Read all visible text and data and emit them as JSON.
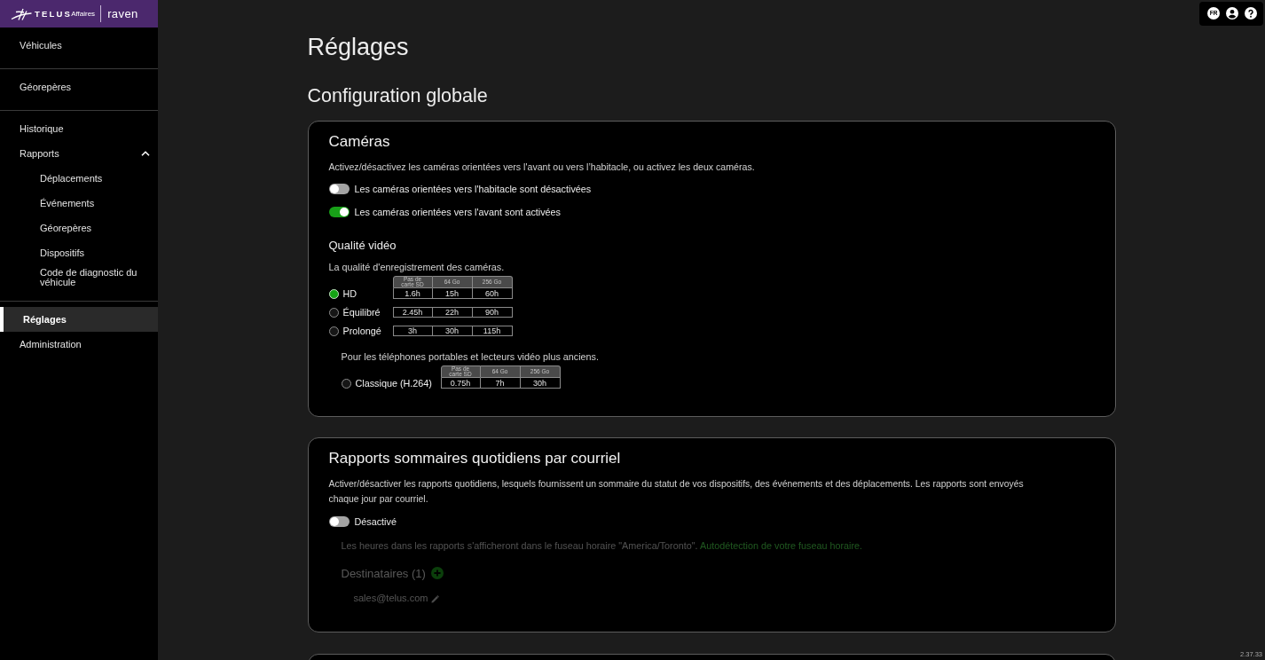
{
  "header": {
    "brand": "TELUS",
    "brand_suffix": "Affaires",
    "product": "raven"
  },
  "sidebar": {
    "groups": [
      [
        {
          "label": "Véhicules",
          "selected": false
        }
      ],
      [
        {
          "label": "Géorepères",
          "selected": false
        }
      ],
      [
        {
          "label": "Historique",
          "selected": false
        },
        {
          "label": "Rapports",
          "selected": false,
          "expanded": true,
          "children": [
            {
              "label": "Déplacements",
              "selected": false
            },
            {
              "label": "Événements",
              "selected": false
            },
            {
              "label": "Géorepères",
              "selected": false
            },
            {
              "label": "Dispositifs",
              "selected": false
            },
            {
              "label": "Code de diagnostic du véhicule",
              "selected": false
            }
          ]
        }
      ],
      [
        {
          "label": "Réglages",
          "selected": true
        },
        {
          "label": "Administration",
          "selected": false
        }
      ]
    ]
  },
  "toolbar": {
    "language": "FR"
  },
  "page_title": "Réglages",
  "section_title": "Configuration globale",
  "cameras": {
    "title": "Caméras",
    "description": "Activez/désactivez les caméras orientées vers l'avant ou vers l’habitacle, ou activez les deux caméras.",
    "toggles": [
      {
        "label": "Les caméras orientées vers l'habitacle sont désactivées",
        "on": false
      },
      {
        "label": "Les caméras orientées vers l'avant sont activées",
        "on": true
      }
    ],
    "video_quality": {
      "title": "Qualité vidéo",
      "description": "La qualité d'enregistrement des caméras.",
      "options": [
        {
          "label": "HD",
          "selected": true,
          "table": {
            "columns": [
              "Pas de carte SD",
              "64 Go",
              "256 Go"
            ],
            "values": [
              "1.6h",
              "15h",
              "60h"
            ]
          }
        },
        {
          "label": "Équilibré",
          "selected": false,
          "table": {
            "values": [
              "2.45h",
              "22h",
              "90h"
            ]
          }
        },
        {
          "label": "Prolongé",
          "selected": false,
          "table": {
            "values": [
              "3h",
              "30h",
              "115h"
            ]
          }
        }
      ],
      "legacy_note": "Pour les téléphones portables et lecteurs vidéo plus anciens.",
      "legacy_options": [
        {
          "label": "Classique (H.264)",
          "selected": false,
          "table": {
            "columns": [
              "Pas de carte SD",
              "64 Go",
              "256 Go"
            ],
            "values": [
              "0.75h",
              "7h",
              "30h"
            ]
          }
        }
      ]
    }
  },
  "daily_reports": {
    "title": "Rapports sommaires quotidiens par courriel",
    "description": "Activer/désactiver les rapports quotidiens, lesquels fournissent un sommaire du statut de vos dispositifs, des événements et des déplacements. Les rapports sont envoyés chaque jour par courriel.",
    "toggle": {
      "label": "Désactivé",
      "on": false
    },
    "timezone_note": "Les heures dans les rapports s'afficheront dans le fuseau horaire \"America/Toronto\".",
    "timezone_link": "Autodétection de votre fuseau horaire.",
    "recipients_title": "Destinataires (1)",
    "recipients": [
      "sales@telus.com"
    ]
  },
  "version": "2.37.33"
}
